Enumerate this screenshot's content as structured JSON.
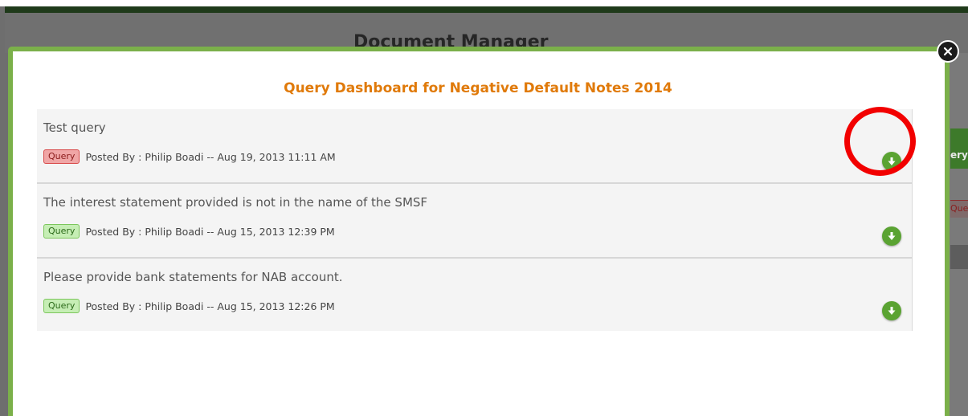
{
  "background": {
    "header_title": "Document Manager",
    "right_tab_text": "ery",
    "right_badge_text": "Que"
  },
  "modal": {
    "title": "Query Dashboard for Negative Default Notes 2014"
  },
  "queries": [
    {
      "text": "Test query",
      "badge": "Query",
      "badge_color": "red",
      "posted": "Posted By : Philip Boadi -- Aug 19, 2013 11:11 AM"
    },
    {
      "text": "The interest statement provided is not in the name of the SMSF",
      "badge": "Query",
      "badge_color": "green",
      "posted": "Posted By : Philip Boadi -- Aug 15, 2013 12:39 PM"
    },
    {
      "text": "Please provide bank statements for NAB account.",
      "badge": "Query",
      "badge_color": "green",
      "posted": "Posted By : Philip Boadi -- Aug 15, 2013 12:26 PM"
    }
  ],
  "colors": {
    "title_orange": "#e07a0a",
    "modal_border_green": "#7bb04a",
    "download_green": "#5aa332",
    "annotation_red": "#f20000"
  },
  "icons": {
    "close": "close-icon",
    "download": "download-arrow-icon"
  }
}
